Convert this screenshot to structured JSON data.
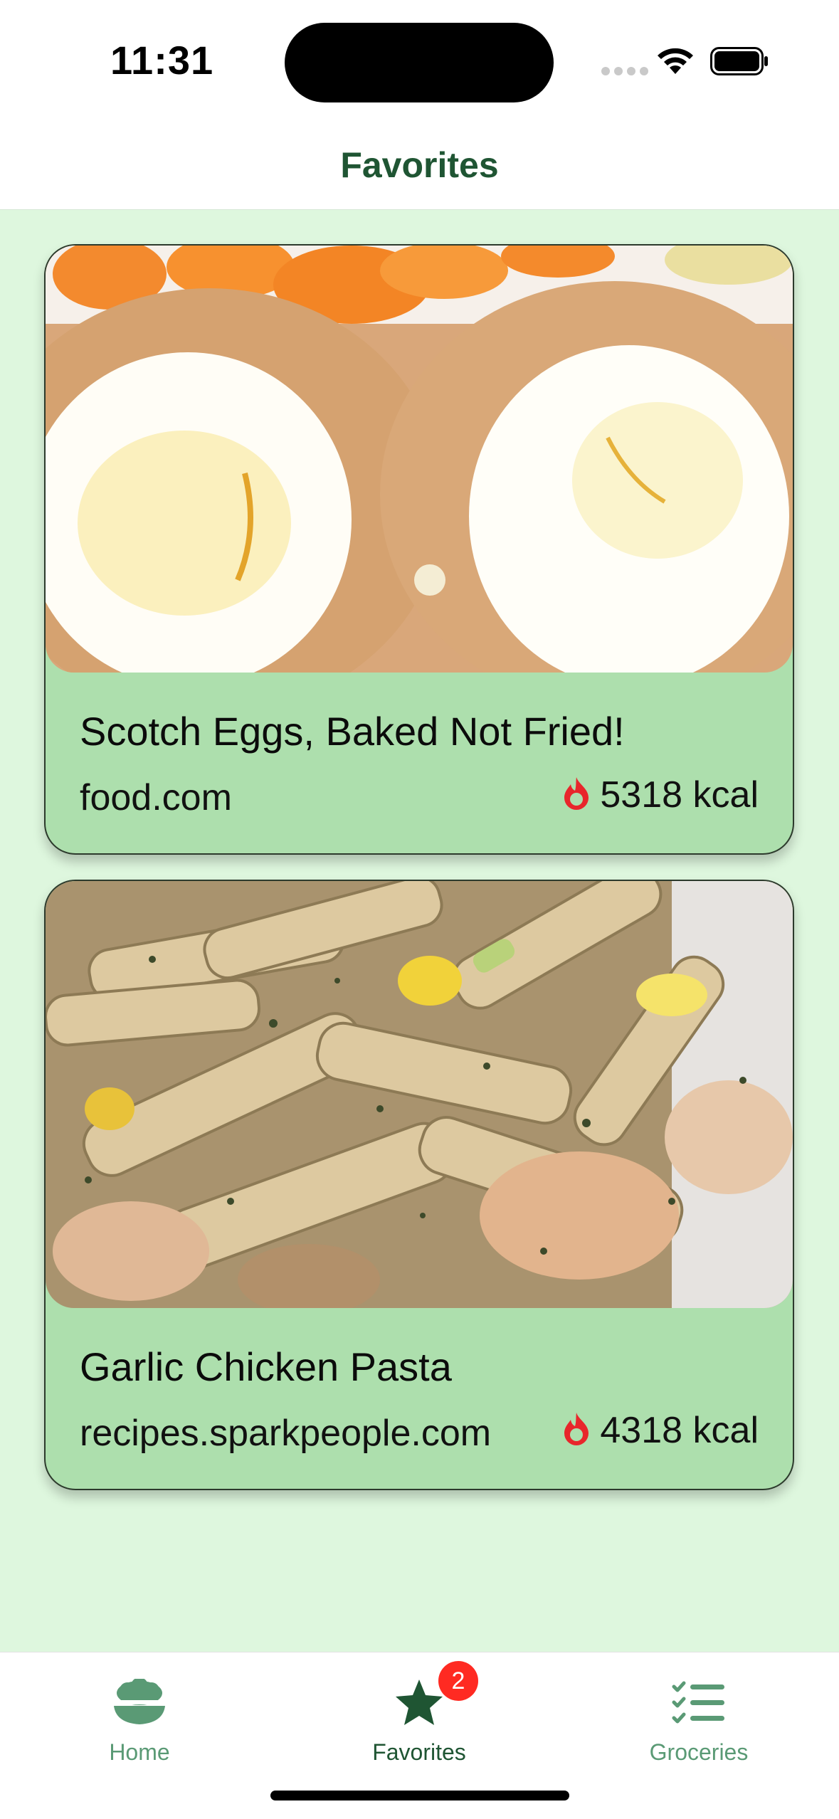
{
  "status_bar": {
    "time": "11:31"
  },
  "header": {
    "title": "Favorites"
  },
  "recipes": [
    {
      "title": "Scotch Eggs, Baked Not Fried!",
      "source": "food.com",
      "calories": "5318 kcal",
      "image_icon": "scotch-eggs-photo"
    },
    {
      "title": "Garlic Chicken Pasta",
      "source": "recipes.sparkpeople.com",
      "calories": "4318 kcal",
      "image_icon": "pasta-photo"
    }
  ],
  "tabs": [
    {
      "label": "Home",
      "icon": "bowl-icon"
    },
    {
      "label": "Favorites",
      "icon": "star-icon",
      "badge": "2",
      "selected": true
    },
    {
      "label": "Groceries",
      "icon": "checklist-icon"
    }
  ],
  "colors": {
    "accent": "#1f5533",
    "tab_inactive": "#5a9a75",
    "card_bg": "#addfad",
    "page_bg": "#def7de",
    "badge": "#ff2a22",
    "flame": "#e8262b"
  }
}
